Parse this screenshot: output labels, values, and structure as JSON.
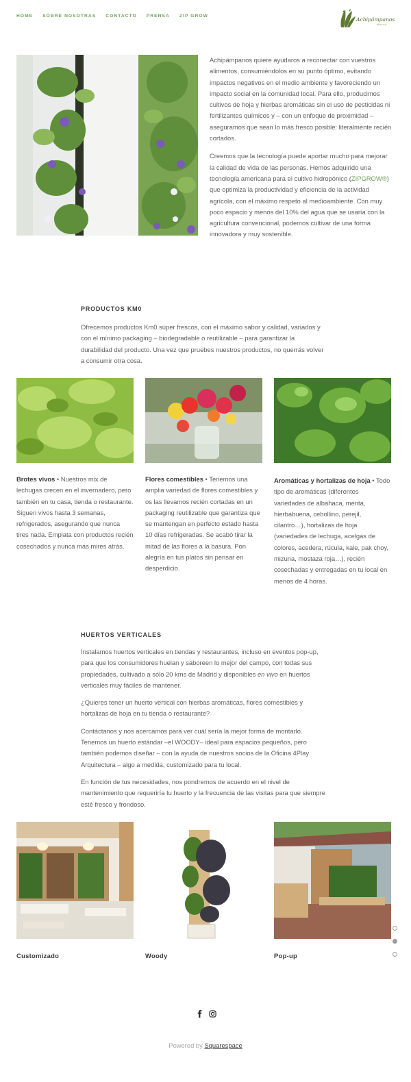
{
  "nav": {
    "items": [
      "HOME",
      "SOBRE NOSOTRAS",
      "CONTACTO",
      "PRENSA",
      "ZIP GROW"
    ]
  },
  "logo": {
    "text": "Achipámpanos",
    "sub": "Madrid"
  },
  "intro": {
    "p1": "Achipámpanos quiere ayudaros a reconectar con vuestros alimentos, consumiéndolos en su punto óptimo, evitando impactos negativos en el medio ambiente y favoreciendo un impacto social en la comunidad local. Para ello, producimos cultivos de hoja y hierbas aromáticas sin el uso de pesticidas ni fertilizantes químicos y – con un enfoque de proximidad – aseguramos que sean lo más fresco posible: literalmente recién cortados.",
    "p2_a": "Creemos que la tecnología puede aportar mucho para mejorar la calidad de vida de las personas. Hemos adquirido una tecnología americana para el cultivo hidropónico (",
    "p2_link": "ZIPGROW®",
    "p2_b": ") que optimiza la productividad y eficiencia de la actividad agrícola, con el máximo respeto al medioambiente. Con muy poco espacio y menos del 10% del agua que se usaría con la agricultura convencional, podemos cultivar de una forma innovadora y muy sostenible."
  },
  "productos": {
    "title": "PRODUCTOS KM0",
    "text": "Ofrecemos productos Km0 súper frescos, con el máximo sabor y calidad, variados y con el mínimo packaging – biodegradable o reutilizable – para garantizar la durabilidad del producto. Una vez que pruebes nuestros productos, no querrás volver a consumir otra cosa.",
    "items": [
      {
        "title": "Brotes vivos",
        "text": " • Nuestros mix de lechugas crecen en el invernadero, pero también en tu casa, tienda o restaurante. Siguen vivos hasta 3 semanas, refrigerados, asegurando que nunca tires nada. Emplata con productos recién cosechados y nunca más mires atrás."
      },
      {
        "title": "Flores comestibles",
        "text": " • Tenemos una amplia variedad de flores comestibles y os las llevamos recién cortadas en un packaging reutilizable que garantiza que se mantengan en perfecto estado hasta 10 días refrigeradas. Se acabó tirar la mitad de las flores a la basura. Pon alegría en tus platos sin pensar en desperdicio."
      },
      {
        "title": "Aromáticas y hortalizas de hoja",
        "text": " • Todo tipo de aromáticas (diferentes variedades de albahaca, menta, hierbabuena, cebollino, perejil, cilantro…),  hortalizas de hoja (variedades de lechuga, acelgas de colores, acedera, rúcula, kale, pak choy, mizuna, mostaza roja…), recién cosechadas y entregadas en tu local en menos de 4 horas."
      }
    ]
  },
  "huertos": {
    "title": "HUERTOS VERTICALES",
    "p1_a": "Instalamos huertos verticales en tiendas y restaurantes, incluso en eventos pop-up, para que los consumidores huelan y saboreen lo mejor del campo, con todas sus propiedades, cultivado a sólo 20 kms de Madrid y disponibles ",
    "p1_em": "en vivo",
    "p1_b": " en huertos verticales muy fáciles de mantener.",
    "p2": "¿Quieres tener un huerto vertical con hierbas aromáticas, flores comestibles y hortalizas de hoja en tu tienda o restaurante?",
    "p3": "Contáctanos y nos acercamos para ver cuál sería la mejor forma de montarlo. Tenemos un huerto estándar –el WOODY– ideal para espacios pequeños, pero también podemos diseñar – con la ayuda de nuestros socios de la Oficina 4Play Arquitectura – algo a medida, customizado para tu local.",
    "p4": "En función de tus necesidades, nos pondremos de acuerdo en el nivel de mantenimiento que requeriría tu huerto y la frecuencia de las visitas para que siempre esté fresco y frondoso.",
    "labels": [
      "Customizado",
      "Woody",
      "Pop-up"
    ]
  },
  "footer": {
    "powered": "Powered by ",
    "squarespace": "Squarespace"
  },
  "icons": [
    "facebook-icon",
    "instagram-icon"
  ],
  "colors": {
    "accent": "#6f9f57",
    "text": "#5d5d5d",
    "heading": "#3e3e3e"
  }
}
